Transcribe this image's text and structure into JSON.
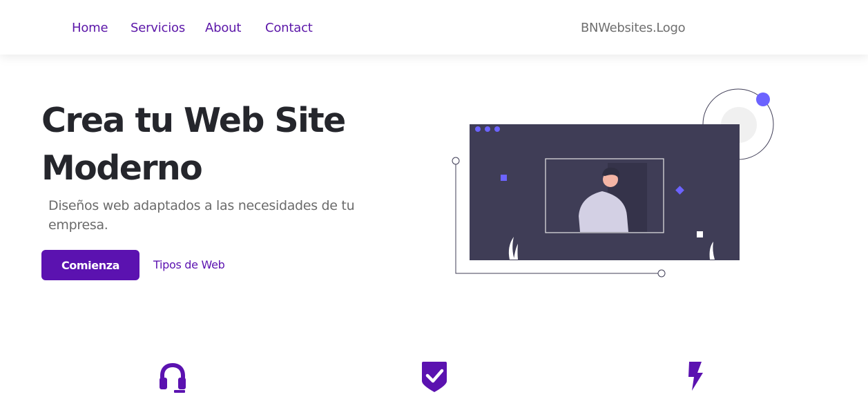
{
  "nav": {
    "items": [
      {
        "label": "Home"
      },
      {
        "label": "Servicios"
      },
      {
        "label": "About"
      },
      {
        "label": "Contact"
      }
    ],
    "logo": "BNWebsites.Logo"
  },
  "hero": {
    "title": "Crea tu Web Site Moderno",
    "subtitle": "Diseños web adaptados a las necesidades de tu empresa.",
    "primary_button": "Comienza",
    "secondary_link": "Tipos de Web"
  },
  "illustration": {
    "icon": "website-profile-illustration"
  },
  "features": [
    {
      "icon": "headset-icon"
    },
    {
      "icon": "shield-check-icon"
    },
    {
      "icon": "lightning-bolt-icon"
    }
  ],
  "colors": {
    "accent": "#5b12b0",
    "nav_link": "#5b16a8",
    "title": "#25262c",
    "subtitle": "#6b6b6b",
    "illustration_dark": "#3f3d56",
    "illustration_accent": "#6c63ff"
  }
}
